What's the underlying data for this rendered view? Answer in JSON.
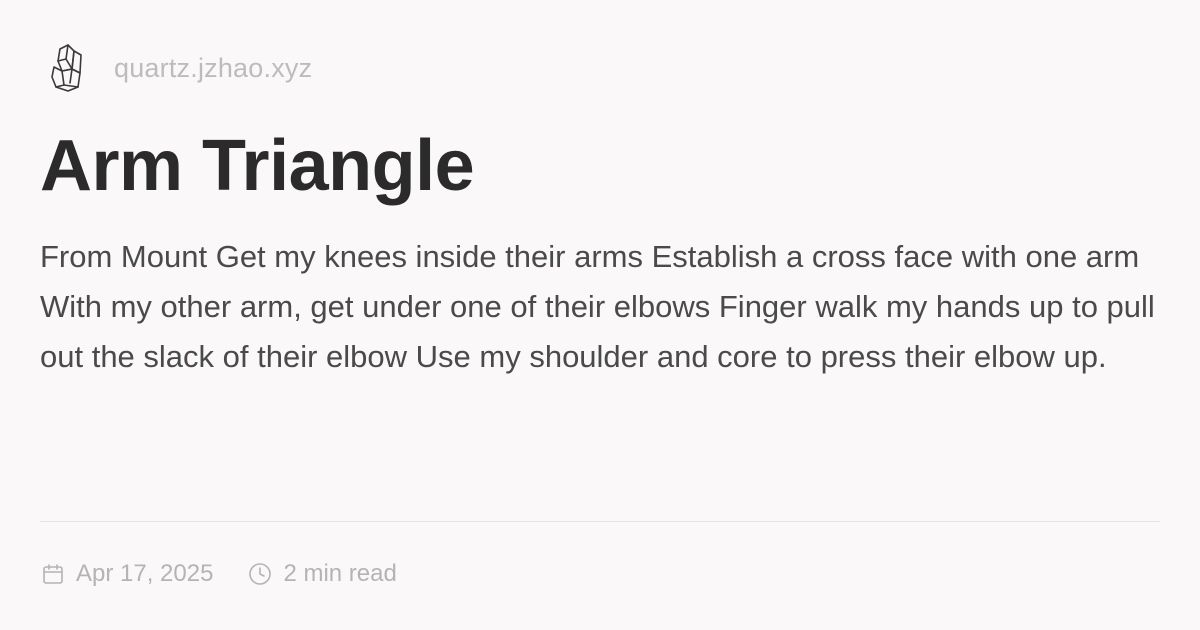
{
  "site": {
    "name": "quartz.jzhao.xyz",
    "logo_icon": "crystal-icon"
  },
  "page": {
    "title": "Arm Triangle",
    "description": "From Mount Get my knees inside their arms Establish a cross face with one arm With my other arm, get under one of their elbows Finger walk my hands up to pull out the slack of their elbow Use my shoulder and core to press their elbow up."
  },
  "meta": {
    "date": "Apr 17, 2025",
    "date_icon": "calendar-icon",
    "reading_time": "2 min read",
    "reading_time_icon": "clock-icon"
  },
  "colors": {
    "background": "#faf8f8",
    "title": "#2b2b2b",
    "body_text": "#4a4a4a",
    "muted": "#bdbcbc"
  }
}
